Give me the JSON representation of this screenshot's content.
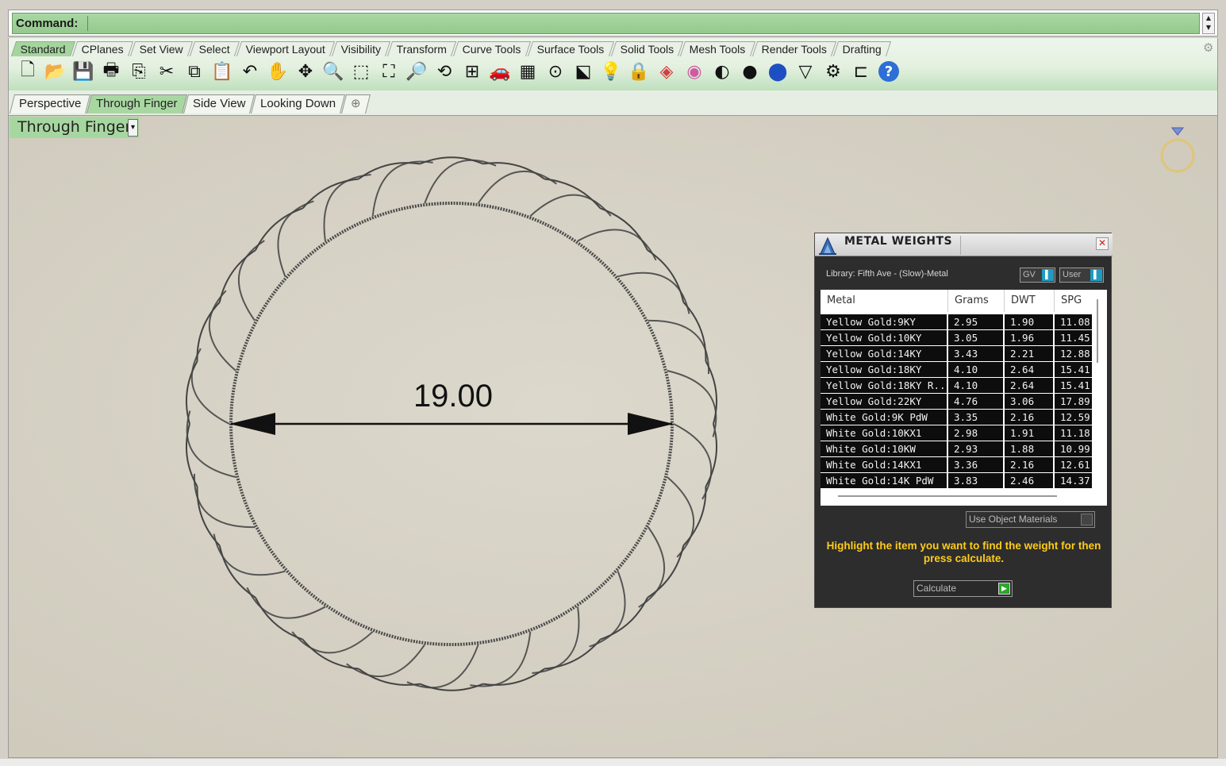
{
  "command": {
    "label": "Command:"
  },
  "toolbar_tabs": [
    "Standard",
    "CPlanes",
    "Set View",
    "Select",
    "Viewport Layout",
    "Visibility",
    "Transform",
    "Curve Tools",
    "Surface Tools",
    "Solid Tools",
    "Mesh Tools",
    "Render Tools",
    "Drafting"
  ],
  "active_toolbar_tab": "Standard",
  "tools": [
    {
      "name": "new-document-icon",
      "glyph": "🗋"
    },
    {
      "name": "open-folder-icon",
      "glyph": "📂"
    },
    {
      "name": "save-icon",
      "glyph": "💾"
    },
    {
      "name": "print-icon",
      "glyph": "🖶"
    },
    {
      "name": "import-icon",
      "glyph": "⎘"
    },
    {
      "name": "cut-icon",
      "glyph": "✂"
    },
    {
      "name": "copy-icon",
      "glyph": "⧉"
    },
    {
      "name": "paste-icon",
      "glyph": "📋"
    },
    {
      "name": "undo-icon",
      "glyph": "↶"
    },
    {
      "name": "pan-hand-icon",
      "glyph": "✋"
    },
    {
      "name": "move-view-icon",
      "glyph": "✥"
    },
    {
      "name": "zoom-icon",
      "glyph": "🔍"
    },
    {
      "name": "zoom-window-icon",
      "glyph": "⬚"
    },
    {
      "name": "zoom-extents-icon",
      "glyph": "⛶"
    },
    {
      "name": "zoom-selected-icon",
      "glyph": "🔎"
    },
    {
      "name": "rotate-view-icon",
      "glyph": "⟲"
    },
    {
      "name": "four-viewports-icon",
      "glyph": "⊞"
    },
    {
      "name": "car-icon",
      "glyph": "🚗"
    },
    {
      "name": "grid-icon",
      "glyph": "▦"
    },
    {
      "name": "snap-icon",
      "glyph": "⊙"
    },
    {
      "name": "select-points-icon",
      "glyph": "⬕"
    },
    {
      "name": "lightbulb-icon",
      "glyph": "💡"
    },
    {
      "name": "lock-icon",
      "glyph": "🔒"
    },
    {
      "name": "layer-icon",
      "glyph": "◈"
    },
    {
      "name": "color-wheel-icon",
      "glyph": "◉"
    },
    {
      "name": "shaded-sphere-icon",
      "glyph": "◐"
    },
    {
      "name": "rendered-sphere-icon",
      "glyph": "●"
    },
    {
      "name": "blue-sphere-icon",
      "glyph": "⬤"
    },
    {
      "name": "light-icon",
      "glyph": "▽"
    },
    {
      "name": "options-gear-icon",
      "glyph": "⚙"
    },
    {
      "name": "dimension-icon",
      "glyph": "⊏"
    },
    {
      "name": "help-icon",
      "glyph": "?"
    }
  ],
  "viewport_tabs": [
    "Perspective",
    "Through Finger",
    "Side View",
    "Looking Down"
  ],
  "active_viewport_tab": "Through Finger",
  "viewport": {
    "title": "Through Finger",
    "dimension_label": "19.00"
  },
  "metal_weights": {
    "title": "METAL WEIGHTS",
    "library": "Library: Fifth Ave - (Slow)-Metal",
    "toggle_gv": "GV",
    "toggle_user": "User",
    "columns": [
      "Metal",
      "Grams",
      "DWT",
      "SPG"
    ],
    "rows": [
      [
        "Yellow Gold:9KY",
        "2.95",
        "1.90",
        "11.08"
      ],
      [
        "Yellow Gold:10KY",
        "3.05",
        "1.96",
        "11.45"
      ],
      [
        "Yellow Gold:14KY",
        "3.43",
        "2.21",
        "12.88"
      ],
      [
        "Yellow Gold:18KY",
        "4.10",
        "2.64",
        "15.41"
      ],
      [
        "Yellow Gold:18KY R...",
        "4.10",
        "2.64",
        "15.41"
      ],
      [
        "Yellow Gold:22KY",
        "4.76",
        "3.06",
        "17.89"
      ],
      [
        "White Gold:9K PdW",
        "3.35",
        "2.16",
        "12.59"
      ],
      [
        "White Gold:10KX1",
        "2.98",
        "1.91",
        "11.18"
      ],
      [
        "White Gold:10KW",
        "2.93",
        "1.88",
        "10.99"
      ],
      [
        "White Gold:14KX1",
        "3.36",
        "2.16",
        "12.61"
      ],
      [
        "White Gold:14K PdW",
        "3.83",
        "2.46",
        "14.37"
      ]
    ],
    "use_object_materials": "Use Object Materials",
    "hint": "Highlight the item you want to find the weight for then press calculate.",
    "calculate": "Calculate"
  },
  "colors": {
    "command_green": "#a9d8a3",
    "viewport_bg": "#d7d2c5",
    "panel_bg": "#2d2d2d",
    "hint_yellow": "#ffcc1a"
  }
}
